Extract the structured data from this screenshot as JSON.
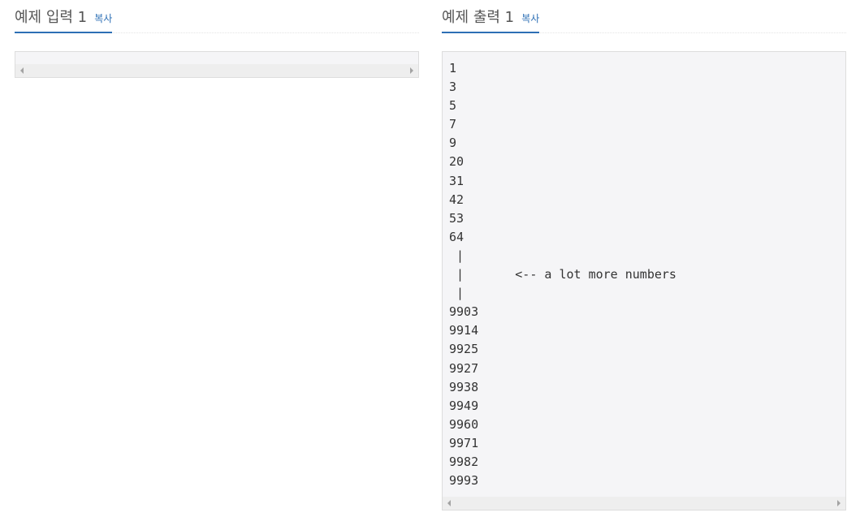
{
  "input": {
    "title": "예제 입력 1",
    "copy_label": "복사",
    "content": ""
  },
  "output": {
    "title": "예제 출력 1",
    "copy_label": "복사",
    "content": "1\n3\n5\n7\n9\n20\n31\n42\n53\n64\n |\n |       <-- a lot more numbers\n |\n9903\n9914\n9925\n9927\n9938\n9949\n9960\n9971\n9982\n9993"
  },
  "icons": {
    "scroll_left": "caret-left-icon",
    "scroll_right": "caret-right-icon"
  },
  "colors": {
    "accent": "#2d6fb5",
    "title_text": "#555555",
    "sample_background": "#f5f5f7"
  }
}
